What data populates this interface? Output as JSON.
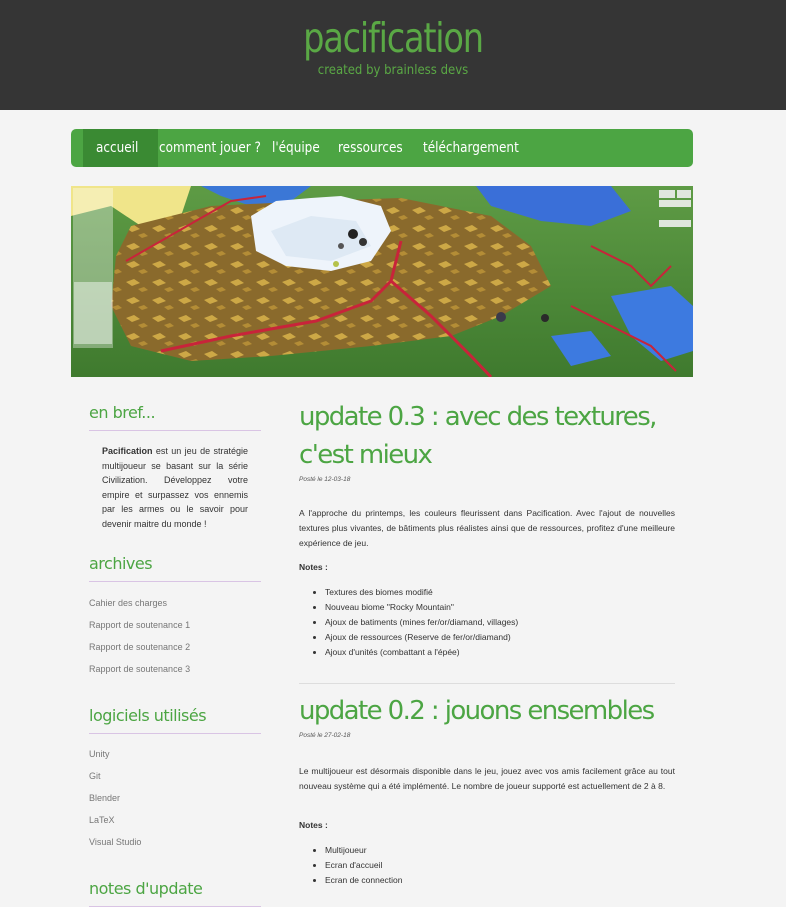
{
  "site": {
    "title": "pacification",
    "tagline": "created by brainless devs"
  },
  "nav": {
    "items": [
      "accueil",
      "comment jouer ?",
      "l'équipe",
      "ressources",
      "téléchargement"
    ],
    "active": "accueil"
  },
  "colors": {
    "header_bg": "#353535",
    "accent_green": "#4ca543",
    "page_bg": "#f4f4f4"
  },
  "sidebar": {
    "about_heading": "en bref...",
    "about_bold": "Pacification",
    "about_text": " est un jeu de stratégie multijoueur se basant sur la série Civilization. Développez votre empire et surpassez vos ennemis par les armes ou le savoir pour devenir maitre du monde !",
    "archives_heading": "archives",
    "archives": [
      "Cahier des charges",
      "Rapport de soutenance 1",
      "Rapport de soutenance 2",
      "Rapport de soutenance 3"
    ],
    "software_heading": "logiciels utilisés",
    "software": [
      "Unity",
      "Git",
      "Blender",
      "LaTeX",
      "Visual Studio"
    ],
    "updates_heading": "notes d'update"
  },
  "posts": [
    {
      "title": "update 0.3 : avec des textures, c'est mieux",
      "date": "Posté le 12-03-18",
      "body": "A l'approche du printemps, les couleurs fleurissent dans Pacification. Avec l'ajout de nouvelles textures plus vivantes, de bâtiments plus réalistes ainsi que de ressources, profitez d'une meilleure expérience de jeu.",
      "notes_label": "Notes :",
      "notes": [
        "Textures des biomes modifié",
        "Nouveau biome \"Rocky Mountain\"",
        "Ajoux de batiments (mines fer/or/diamand, villages)",
        "Ajoux de ressources (Reserve de fer/or/diamand)",
        "Ajoux d'unités (combattant a l'épée)"
      ]
    },
    {
      "title": "update 0.2 : jouons ensembles",
      "date": "Posté le 27-02-18",
      "body": "Le multijoueur est désormais disponible dans le jeu, jouez avec vos amis facilement grâce au tout nouveau système qui a été implémenté. Le nombre de joueur supporté est actuellement de 2 à 8.",
      "notes_label": "Notes :",
      "notes": [
        "Multijoueur",
        "Ecran d'accueil",
        "Ecran de connection"
      ]
    }
  ]
}
